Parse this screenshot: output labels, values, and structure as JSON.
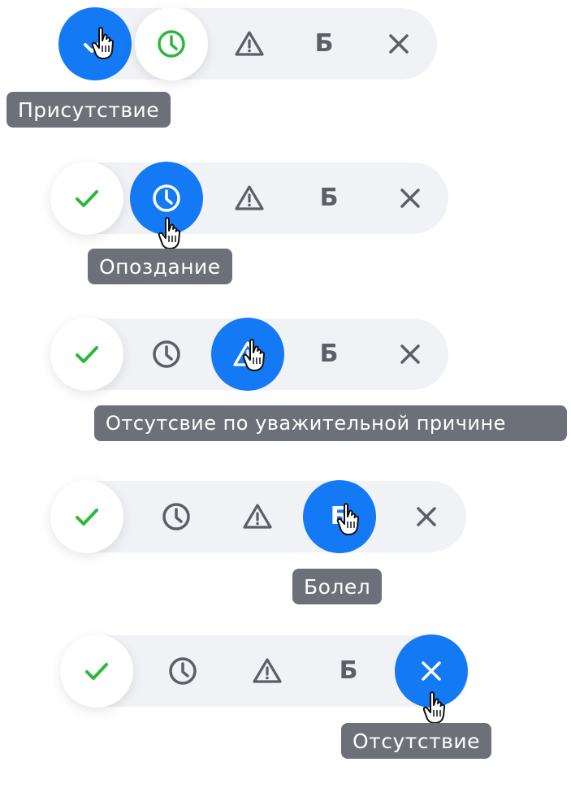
{
  "rows": [
    {
      "active": "present",
      "tooltip": "Присутствие"
    },
    {
      "active": "late",
      "tooltip": "Опоздание"
    },
    {
      "active": "excused",
      "tooltip": "Отсутсвие по уважительной причине"
    },
    {
      "active": "sick",
      "tooltip": "Болел"
    },
    {
      "active": "absent",
      "tooltip": "Отсутствие"
    }
  ],
  "options": {
    "present": {
      "icon": "check-icon"
    },
    "late": {
      "icon": "clock-icon"
    },
    "excused": {
      "icon": "warning-triangle-icon"
    },
    "sick": {
      "icon": "letter-b-icon",
      "glyph": "Б"
    },
    "absent": {
      "icon": "close-icon"
    }
  },
  "colors": {
    "accent": "#1479f4",
    "check_green": "#2db83d",
    "icon_gray": "#5b5f66",
    "tooltip_bg": "#6d7079",
    "pill_bg": "#f1f2f6"
  }
}
